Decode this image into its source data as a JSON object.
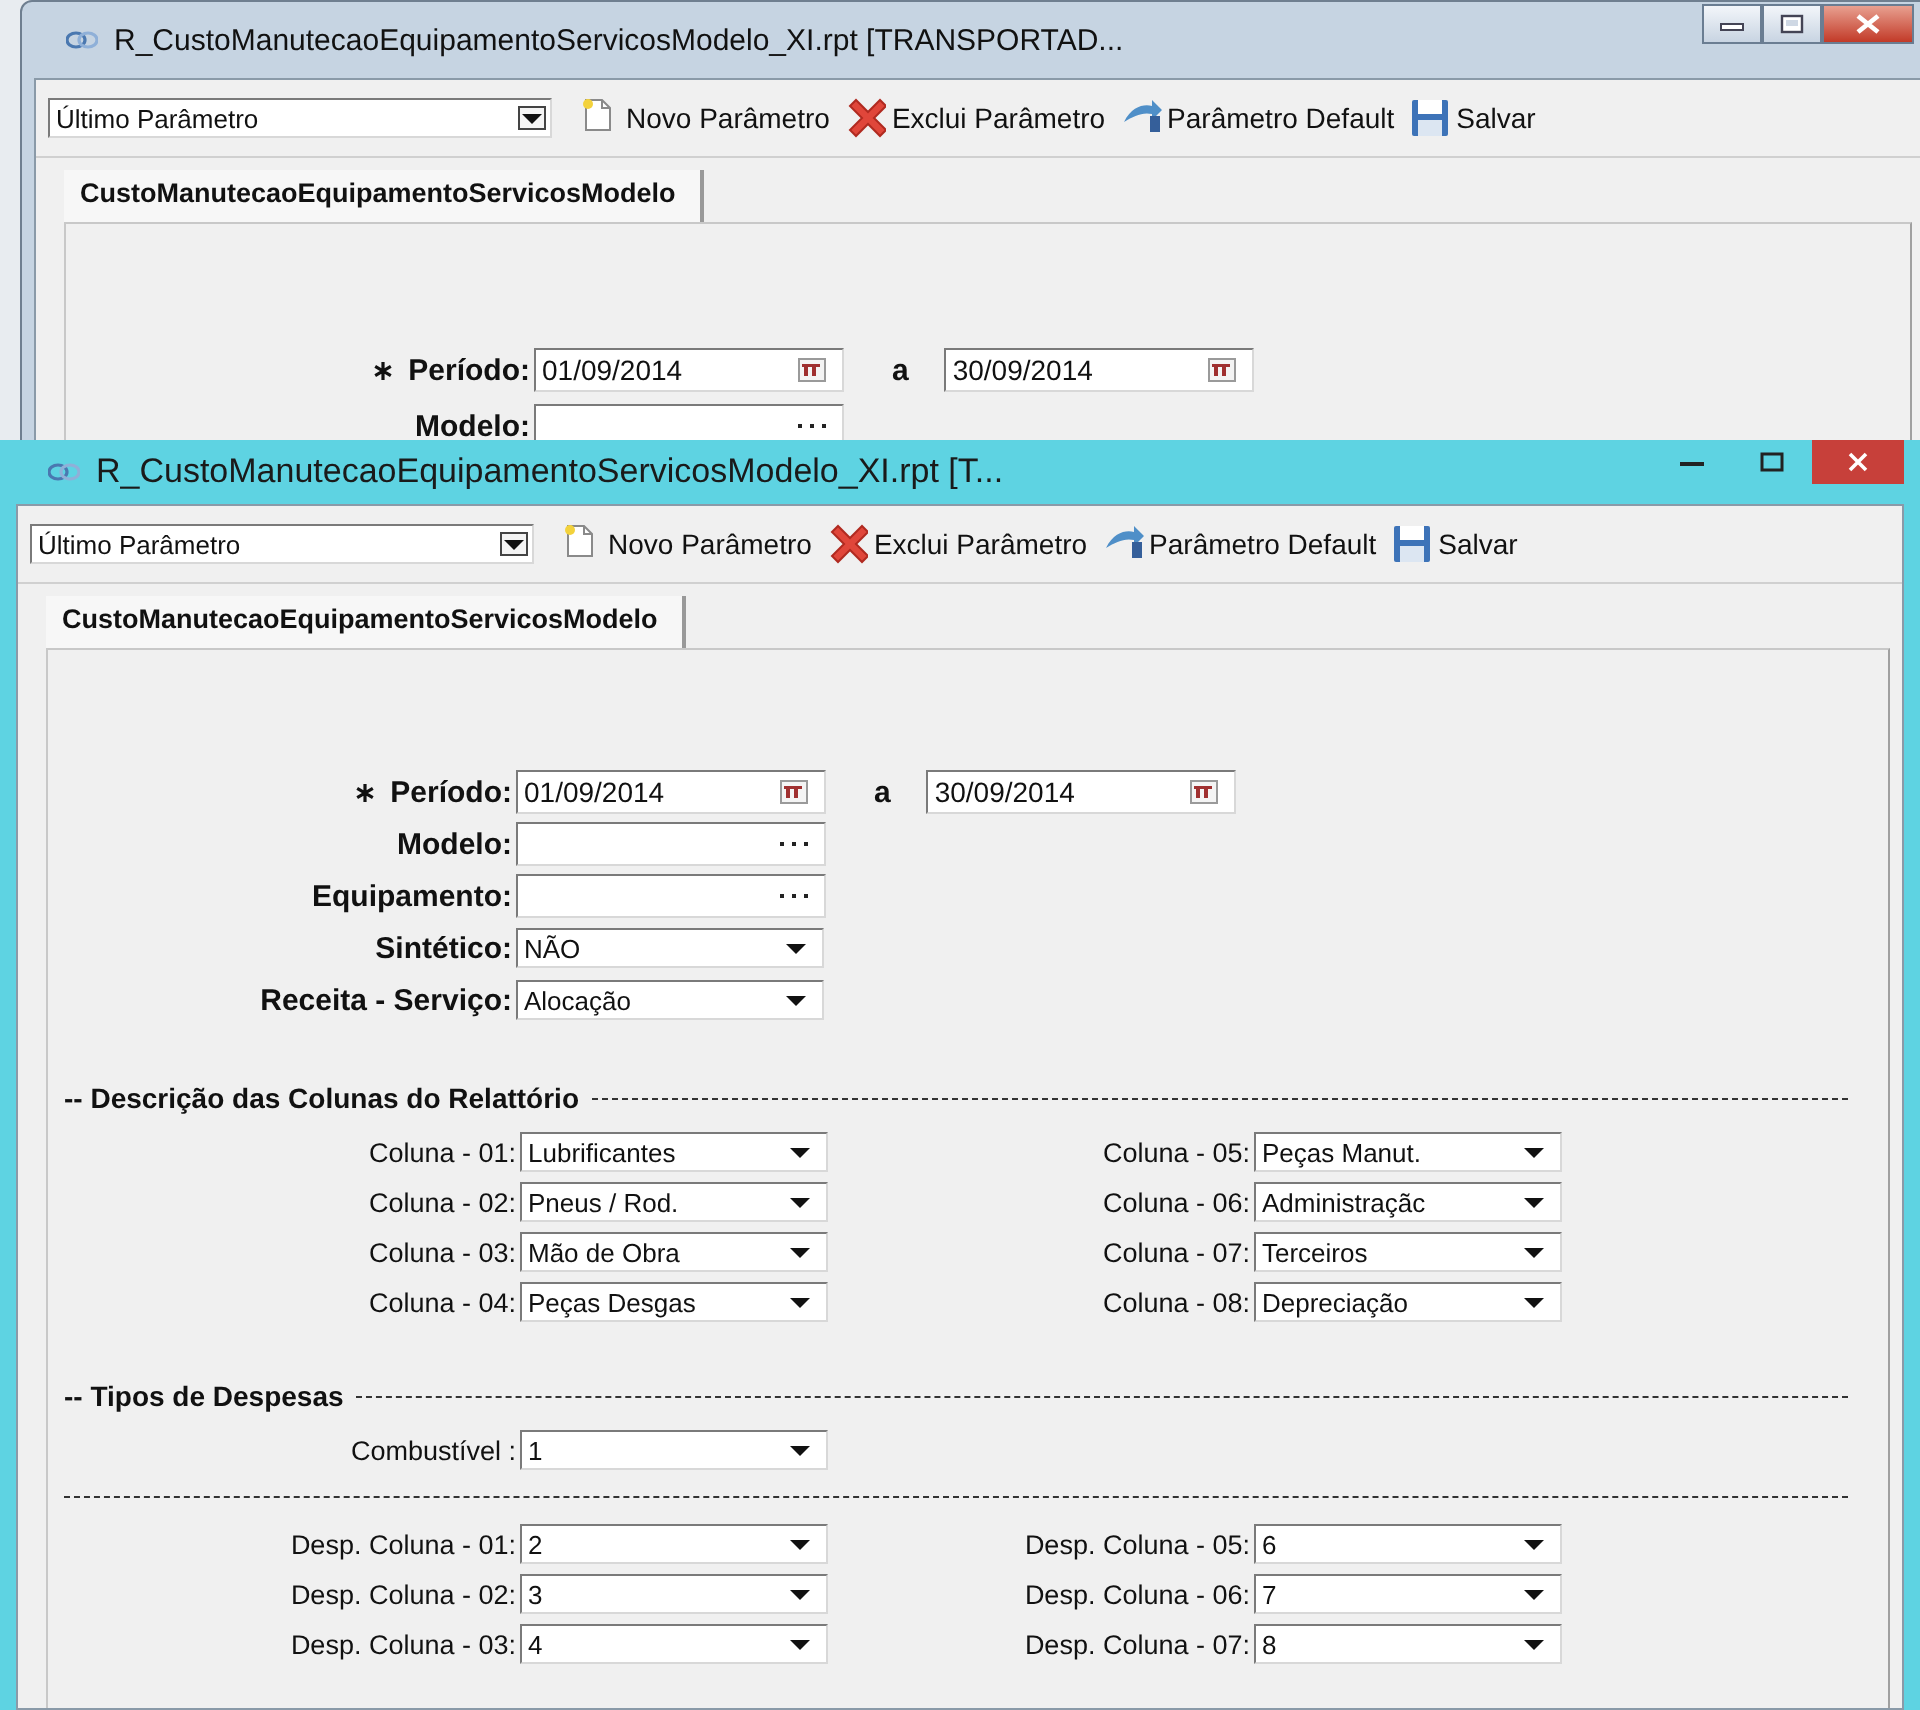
{
  "windows": [
    {
      "title": "R_CustoManutecaoEquipamentoServicosModelo_XI.rpt [TRANSPORTAD...",
      "active": false,
      "toolbar": {
        "preset": "Último Parâmetro",
        "buttons": [
          {
            "label": "Novo Parâmetro",
            "kind": "new"
          },
          {
            "label": "Exclui Parâmetro",
            "kind": "delete"
          },
          {
            "label": "Parâmetro Default",
            "kind": "default"
          },
          {
            "label": "Salvar",
            "kind": "save"
          }
        ]
      },
      "tabs": [
        {
          "label": "CustoManutecaoEquipamentoServicosModelo",
          "selected": true
        }
      ],
      "fields": [
        {
          "label": "Período:",
          "kind": "date_range",
          "required": true,
          "from": "01/09/2014",
          "separator": "a",
          "to": "30/09/2014"
        },
        {
          "label": "Modelo:",
          "kind": "lookup",
          "required": false
        }
      ]
    },
    {
      "title": "R_CustoManutecaoEquipamentoServicosModelo_XI.rpt [T...",
      "active": true,
      "toolbar": {
        "preset": "Último Parâmetro",
        "buttons": [
          {
            "label": "Novo Parâmetro",
            "kind": "new"
          },
          {
            "label": "Exclui Parâmetro",
            "kind": "delete"
          },
          {
            "label": "Parâmetro Default",
            "kind": "default"
          },
          {
            "label": "Salvar",
            "kind": "save"
          }
        ]
      },
      "tabs": [
        {
          "label": "CustoManutecaoEquipamentoServicosModelo",
          "selected": true
        }
      ],
      "fields": [
        {
          "label": "Período:",
          "kind": "date_range",
          "required": true,
          "from": "01/09/2014",
          "separator": "a",
          "to": "30/09/2014"
        },
        {
          "label": "Modelo:",
          "kind": "lookup",
          "required": false
        },
        {
          "label": "Equipamento:",
          "kind": "lookup",
          "required": false
        },
        {
          "label": "Sintético:",
          "kind": "select",
          "required": false,
          "value": "NÃO"
        },
        {
          "label": "Receita - Serviço:",
          "kind": "select",
          "required": false,
          "value": "Alocação"
        }
      ],
      "sections": [
        {
          "kind": "heading",
          "text": "-- Descrição das Colunas do Relattório"
        },
        {
          "kind": "columns",
          "left": [
            {
              "label": "Coluna - 01:",
              "value": "Lubrificantes"
            },
            {
              "label": "Coluna - 02:",
              "value": "Pneus / Rod."
            },
            {
              "label": "Coluna - 03:",
              "value": "Mão de Obra"
            },
            {
              "label": "Coluna - 04:",
              "value": "Peças Desgas"
            }
          ],
          "right": [
            {
              "label": "Coluna - 05:",
              "value": "Peças Manut."
            },
            {
              "label": "Coluna - 06:",
              "value": "Administraçãc"
            },
            {
              "label": "Coluna - 07:",
              "value": "Terceiros"
            },
            {
              "label": "Coluna - 08:",
              "value": "Depreciação"
            }
          ]
        },
        {
          "kind": "heading",
          "text": "-- Tipos de Despesas"
        },
        {
          "kind": "columns",
          "left": [
            {
              "label": "Combustível :",
              "value": "1"
            }
          ]
        },
        {
          "kind": "rule"
        },
        {
          "kind": "columns",
          "left": [
            {
              "label": "Desp. Coluna - 01:",
              "value": "2"
            },
            {
              "label": "Desp. Coluna - 02:",
              "value": "3"
            },
            {
              "label": "Desp. Coluna - 03:",
              "value": "4"
            }
          ],
          "right": [
            {
              "label": "Desp. Coluna - 05:",
              "value": "6"
            },
            {
              "label": "Desp. Coluna - 06:",
              "value": "7"
            },
            {
              "label": "Desp. Coluna - 07:",
              "value": "8"
            }
          ]
        }
      ]
    }
  ]
}
